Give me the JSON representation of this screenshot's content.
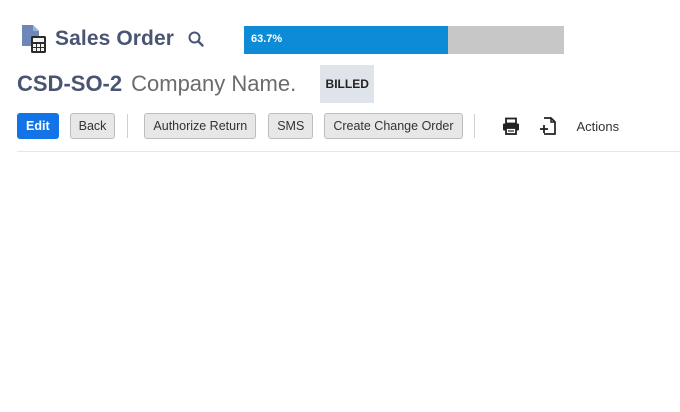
{
  "header": {
    "record_type": "Sales Order",
    "record_icon": "sales-order-calculator-icon",
    "search_icon": "search-icon"
  },
  "progress": {
    "label": "63.7%",
    "value": 0.637,
    "fill_color": "#0e8bd6",
    "track_color": "#c7c7c7"
  },
  "record": {
    "id": "CSD-SO-2",
    "company": "Company Name.",
    "status": "BILLED"
  },
  "toolbar": {
    "edit_label": "Edit",
    "back_label": "Back",
    "authorize_return_label": "Authorize Return",
    "sms_label": "SMS",
    "create_change_order_label": "Create Change Order",
    "print_icon": "print-icon",
    "new_icon": "new-document-icon",
    "actions_label": "Actions"
  },
  "colors": {
    "primary": "#1274e6",
    "title": "#4a5573"
  }
}
